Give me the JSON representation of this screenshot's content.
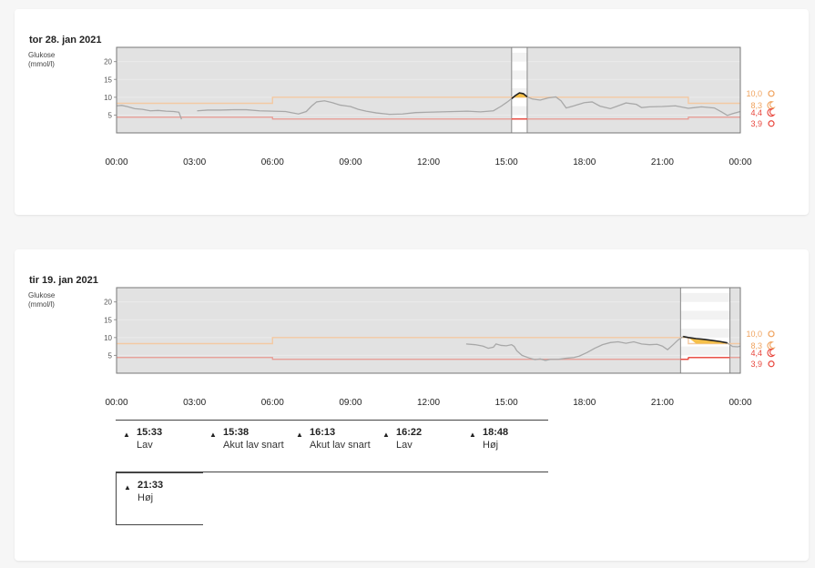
{
  "y_axis_label_line1": "Glukose",
  "y_axis_label_line2": "(mmol/l)",
  "chart_data": [
    {
      "type": "line",
      "title": "tor 28. jan 2021",
      "ylabel": "Glukose (mmol/l)",
      "ylim": [
        0,
        24
      ],
      "y_ticks": [
        5,
        10,
        15,
        20
      ],
      "x_ticks": [
        "00:00",
        "03:00",
        "06:00",
        "09:00",
        "12:00",
        "15:00",
        "18:00",
        "21:00",
        "00:00"
      ],
      "xlim_hours": [
        0,
        24
      ],
      "threshold_labels": [
        "10,0",
        "8,3",
        "4,4",
        "3,9"
      ],
      "threshold_icons": [
        "sun-icon",
        "moon-icon",
        "moon-icon",
        "sun-icon"
      ],
      "threshold_colors": [
        "#f0a35e",
        "#f0a35e",
        "#e8463c",
        "#e8463c"
      ],
      "target_upper": [
        {
          "from": 0,
          "to": 6,
          "value": 8.3
        },
        {
          "from": 6,
          "to": 22,
          "value": 10.0
        },
        {
          "from": 22,
          "to": 24,
          "value": 8.3
        }
      ],
      "target_lower": [
        {
          "from": 0,
          "to": 6,
          "value": 4.4
        },
        {
          "from": 6,
          "to": 22,
          "value": 3.9
        },
        {
          "from": 22,
          "to": 24,
          "value": 4.4
        }
      ],
      "highlight_window": [
        15.2,
        15.8
      ],
      "series": [
        {
          "segments": [
            [
              [
                0,
                7.6
              ],
              [
                0.2,
                7.7
              ],
              [
                0.4,
                7.4
              ],
              [
                0.7,
                6.8
              ],
              [
                1.0,
                6.6
              ],
              [
                1.3,
                6.2
              ],
              [
                1.6,
                6.3
              ],
              [
                1.9,
                6.1
              ],
              [
                2.2,
                6.0
              ],
              [
                2.4,
                5.8
              ],
              [
                2.5,
                3.8
              ]
            ],
            [
              [
                3.1,
                6.2
              ],
              [
                3.5,
                6.4
              ],
              [
                4.0,
                6.4
              ],
              [
                4.5,
                6.5
              ],
              [
                5.0,
                6.5
              ],
              [
                5.5,
                6.2
              ],
              [
                6.0,
                6.1
              ],
              [
                6.5,
                6.0
              ],
              [
                7.0,
                5.3
              ],
              [
                7.3,
                6.0
              ],
              [
                7.5,
                7.5
              ],
              [
                7.7,
                8.7
              ],
              [
                8.0,
                9.0
              ],
              [
                8.3,
                8.5
              ],
              [
                8.6,
                7.8
              ],
              [
                9.0,
                7.4
              ],
              [
                9.3,
                6.6
              ],
              [
                9.6,
                6.1
              ],
              [
                10.0,
                5.6
              ],
              [
                10.5,
                5.2
              ],
              [
                11.0,
                5.3
              ],
              [
                11.5,
                5.7
              ],
              [
                12.0,
                5.8
              ],
              [
                12.5,
                5.9
              ],
              [
                13.0,
                6.0
              ],
              [
                13.5,
                6.1
              ],
              [
                14.0,
                5.9
              ],
              [
                14.5,
                6.2
              ],
              [
                14.8,
                7.5
              ],
              [
                15.0,
                8.5
              ],
              [
                15.2,
                9.6
              ],
              [
                15.35,
                10.5
              ],
              [
                15.5,
                11.2
              ],
              [
                15.65,
                11.0
              ],
              [
                15.8,
                10.1
              ],
              [
                16.0,
                9.5
              ],
              [
                16.3,
                9.2
              ],
              [
                16.6,
                9.8
              ],
              [
                16.9,
                10.1
              ],
              [
                17.1,
                9.0
              ],
              [
                17.3,
                7.0
              ],
              [
                17.6,
                7.6
              ],
              [
                18.0,
                8.5
              ],
              [
                18.3,
                8.7
              ],
              [
                18.6,
                7.5
              ],
              [
                19.0,
                6.8
              ],
              [
                19.3,
                7.6
              ],
              [
                19.6,
                8.4
              ],
              [
                20.0,
                8.0
              ],
              [
                20.2,
                7.1
              ],
              [
                20.5,
                7.3
              ],
              [
                21.0,
                7.4
              ],
              [
                21.5,
                7.6
              ],
              [
                22.0,
                6.9
              ],
              [
                22.5,
                7.3
              ],
              [
                23.0,
                7.0
              ],
              [
                23.3,
                5.8
              ],
              [
                23.5,
                4.9
              ],
              [
                23.7,
                5.4
              ],
              [
                24.0,
                6.0
              ]
            ]
          ]
        }
      ]
    },
    {
      "type": "line",
      "title": "tir 19. jan 2021",
      "ylabel": "Glukose (mmol/l)",
      "ylim": [
        0,
        24
      ],
      "y_ticks": [
        5,
        10,
        15,
        20
      ],
      "x_ticks": [
        "00:00",
        "03:00",
        "06:00",
        "09:00",
        "12:00",
        "15:00",
        "18:00",
        "21:00",
        "00:00"
      ],
      "xlim_hours": [
        0,
        24
      ],
      "threshold_labels": [
        "10,0",
        "8,3",
        "4,4",
        "3,9"
      ],
      "threshold_icons": [
        "sun-icon",
        "moon-icon",
        "moon-icon",
        "sun-icon"
      ],
      "threshold_colors": [
        "#f0a35e",
        "#f0a35e",
        "#e8463c",
        "#e8463c"
      ],
      "target_upper": [
        {
          "from": 0,
          "to": 6,
          "value": 8.3
        },
        {
          "from": 6,
          "to": 22,
          "value": 10.0
        },
        {
          "from": 22,
          "to": 24,
          "value": 8.3
        }
      ],
      "target_lower": [
        {
          "from": 0,
          "to": 6,
          "value": 4.4
        },
        {
          "from": 6,
          "to": 22,
          "value": 3.9
        },
        {
          "from": 22,
          "to": 24,
          "value": 4.4
        }
      ],
      "highlight_window": [
        21.7,
        23.6
      ],
      "series": [
        {
          "segments": [
            [
              [
                13.45,
                8.2
              ],
              [
                13.8,
                8.0
              ],
              [
                14.1,
                7.6
              ],
              [
                14.3,
                7.0
              ],
              [
                14.5,
                7.3
              ],
              [
                14.6,
                8.2
              ],
              [
                14.8,
                7.8
              ],
              [
                15.0,
                7.7
              ],
              [
                15.2,
                8.0
              ],
              [
                15.3,
                7.5
              ],
              [
                15.4,
                6.3
              ],
              [
                15.6,
                5.0
              ],
              [
                15.9,
                4.2
              ],
              [
                16.1,
                3.8
              ],
              [
                16.3,
                4.0
              ],
              [
                16.5,
                3.6
              ],
              [
                16.7,
                3.9
              ],
              [
                17.0,
                3.9
              ],
              [
                17.3,
                4.2
              ],
              [
                17.6,
                4.4
              ],
              [
                17.8,
                4.8
              ],
              [
                18.1,
                5.8
              ],
              [
                18.4,
                7.0
              ],
              [
                18.7,
                8.0
              ],
              [
                19.0,
                8.6
              ],
              [
                19.3,
                8.8
              ],
              [
                19.6,
                8.4
              ],
              [
                19.9,
                8.8
              ],
              [
                20.2,
                8.2
              ],
              [
                20.5,
                8.0
              ],
              [
                20.8,
                8.1
              ],
              [
                21.0,
                7.6
              ],
              [
                21.2,
                6.6
              ],
              [
                21.4,
                7.9
              ],
              [
                21.6,
                9.3
              ],
              [
                21.8,
                10.3
              ],
              [
                22.0,
                10.0
              ],
              [
                22.3,
                9.7
              ],
              [
                22.6,
                9.5
              ],
              [
                22.9,
                9.2
              ],
              [
                23.2,
                8.9
              ],
              [
                23.5,
                8.5
              ],
              [
                23.7,
                7.5
              ],
              [
                23.9,
                7.4
              ],
              [
                24.0,
                7.6
              ]
            ]
          ]
        }
      ]
    }
  ],
  "events": [
    [
      {
        "time": "15:33",
        "label": "Lav"
      },
      {
        "time": "15:38",
        "label": "Akut lav snart"
      },
      {
        "time": "16:13",
        "label": "Akut lav snart"
      },
      {
        "time": "16:22",
        "label": "Lav"
      },
      {
        "time": "18:48",
        "label": "Høj"
      }
    ],
    [
      {
        "time": "21:33",
        "label": "Høj"
      }
    ]
  ],
  "colors": {
    "plot_bg": "#e2e2e2",
    "glucose_line": "#a8a8a8",
    "glucose_highlight": "#222222",
    "high_fill": "#f5c04a",
    "target_upper": "#f3c9a3",
    "target_lower": "#e89890",
    "hi_label": "#f0a35e",
    "lo_label": "#e8463c"
  }
}
